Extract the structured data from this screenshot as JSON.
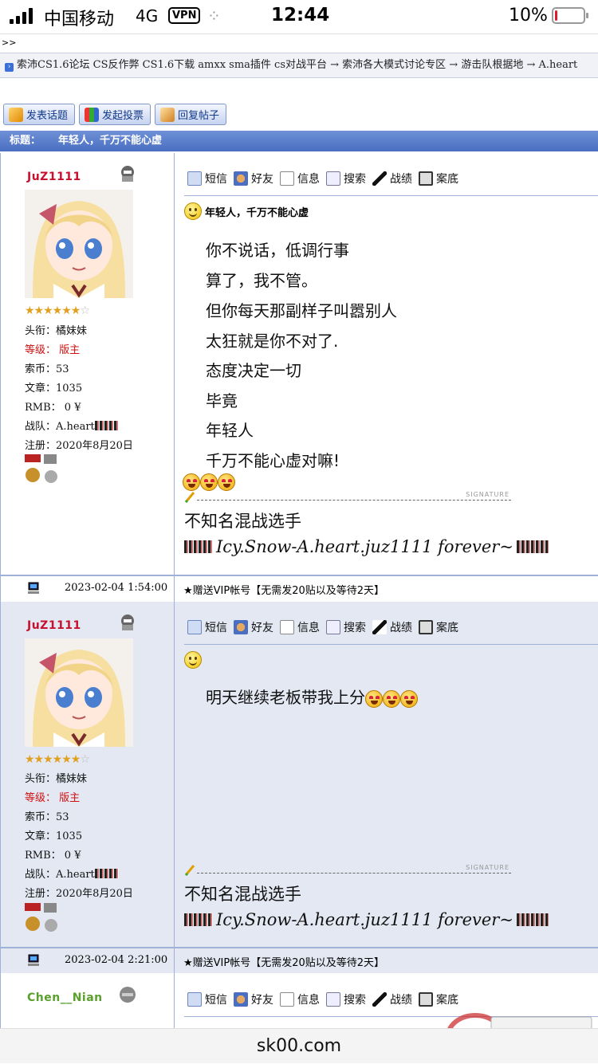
{
  "status": {
    "carrier": "中国移动",
    "network": "4G",
    "vpn": "VPN",
    "time": "12:44",
    "battery": "10%",
    "battery_level": 0.1,
    "activity_glyph": "⁘"
  },
  "crumb_top": ">>",
  "breadcrumb": "索沛CS1.6论坛 CS反作弊 CS1.6下载 amxx sma插件 cs对战平台 → 索沛各大模式讨论专区 → 游击队根据地 → A.heart",
  "actions": [
    {
      "label": "发表话题",
      "icon": "new-topic-icon"
    },
    {
      "label": "发起投票",
      "icon": "poll-icon"
    },
    {
      "label": "回复帖子",
      "icon": "reply-icon"
    }
  ],
  "thread": {
    "title_label": "标题：",
    "title": "年轻人，千万不能心虚"
  },
  "toolbar": [
    "短信",
    "好友",
    "信息",
    "搜索",
    "战绩",
    "案底"
  ],
  "posts": [
    {
      "user": {
        "name": "JuZ1111",
        "rank_stars": "★★★★★★",
        "rank_empty": "☆",
        "title": "头衔：橘妹妹",
        "level_label": "等级：",
        "level": "版主",
        "coins": "索币：53",
        "articles": "文章：1035",
        "rmb": "RMB： 0 ¥",
        "team": "战队：A.heart",
        "joined": "注册：2020年8月20日"
      },
      "post_title": "年轻人，千万不能心虚",
      "lines": [
        "你不说话，低调行事",
        "算了，我不管。",
        "但你每天那副样子叫嚣别人",
        "太狂就是你不对了.",
        "态度决定一切",
        "毕竟",
        "年轻人",
        "千万不能心虚对嘛!"
      ],
      "sig_word": "SIGNATURE",
      "sig_name": "不知名混战选手",
      "sig_motto": "Icy.Snow-A.heart.juz1111 forever~",
      "date": "2023-02-04 1:54:00",
      "vip": "★赠送VIP帐号【无需发20贴以及等待2天】"
    },
    {
      "user": {
        "name": "JuZ1111",
        "rank_stars": "★★★★★★",
        "rank_empty": "☆",
        "title": "头衔：橘妹妹",
        "level_label": "等级：",
        "level": "版主",
        "coins": "索币：53",
        "articles": "文章：1035",
        "rmb": "RMB： 0 ¥",
        "team": "战队：A.heart",
        "joined": "注册：2020年8月20日"
      },
      "lines": [
        "明天继续老板带我上分"
      ],
      "sig_word": "SIGNATURE",
      "sig_name": "不知名混战选手",
      "sig_motto": "Icy.Snow-A.heart.juz1111 forever~",
      "date": "2023-02-04 2:21:00",
      "vip": "★赠送VIP帐号【无需发20贴以及等待2天】"
    },
    {
      "user": {
        "name": "Chen__Nian"
      }
    }
  ],
  "url": "sk00.com",
  "colors": {
    "accent": "#4a6fc2",
    "moderator_red": "#c8102e",
    "post_bg_alt": "#e3e8f3"
  }
}
